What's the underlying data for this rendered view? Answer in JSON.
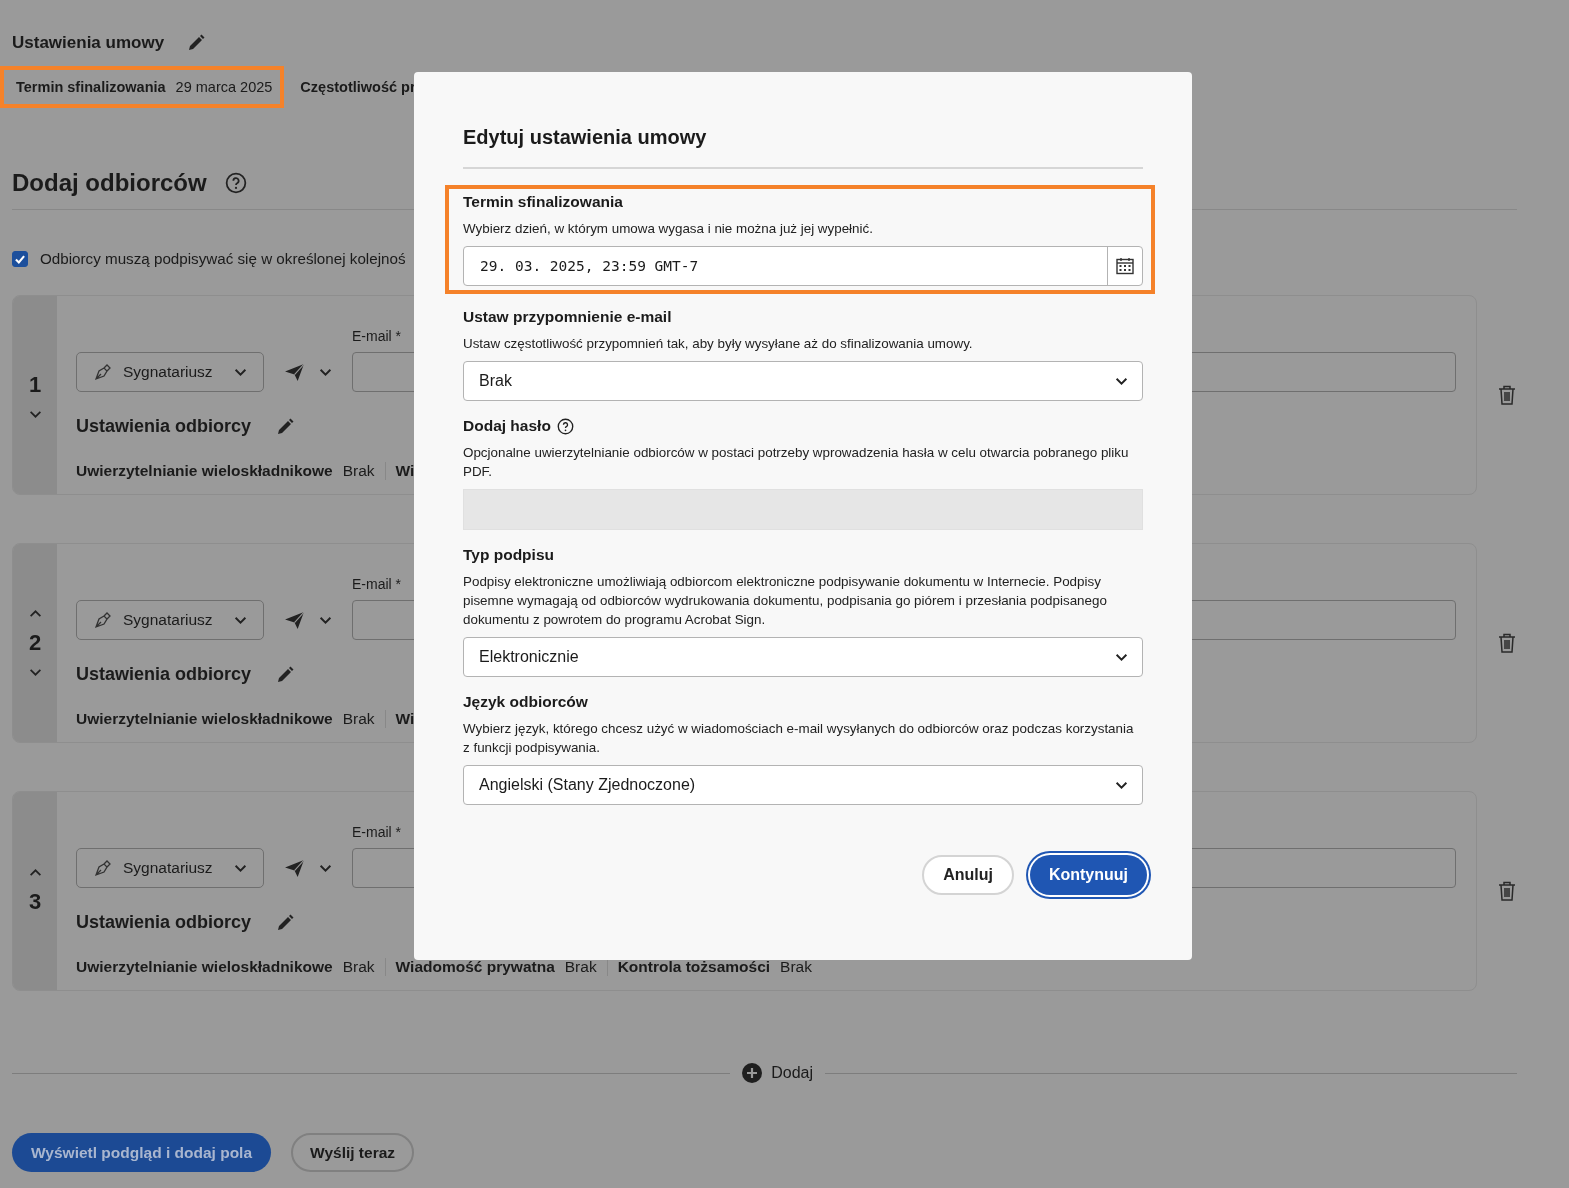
{
  "agreement_settings": {
    "title": "Ustawienia umowy",
    "summary": [
      {
        "label": "Termin sfinalizowania",
        "value": "29 marca 2025",
        "highlighted": true
      },
      {
        "label": "Częstotliwość pr",
        "highlighted": false
      }
    ]
  },
  "recipients": {
    "title": "Dodaj odbiorców",
    "ordered_signing": {
      "label": "Odbiorcy muszą podpisywać się w określonej kolejnoś",
      "checked": true
    },
    "list": [
      {
        "number": "1",
        "can_move_up": false,
        "can_move_down": true,
        "role": "Sygnatariusz",
        "email_label": "E-mail",
        "required_mark": "*",
        "settings_title": "Ustawienia odbiorcy",
        "settings": [
          {
            "label": "Uwierzytelnianie wieloskładnikowe",
            "value": "Brak"
          },
          {
            "label": "Wi"
          }
        ]
      },
      {
        "number": "2",
        "can_move_up": true,
        "can_move_down": true,
        "role": "Sygnatariusz",
        "email_label": "E-mail",
        "required_mark": "*",
        "settings_title": "Ustawienia odbiorcy",
        "settings": [
          {
            "label": "Uwierzytelnianie wieloskładnikowe",
            "value": "Brak"
          },
          {
            "label": "Wi"
          }
        ]
      },
      {
        "number": "3",
        "can_move_up": true,
        "can_move_down": false,
        "role": "Sygnatariusz",
        "email_label": "E-mail",
        "required_mark": "*",
        "settings_title": "Ustawienia odbiorcy",
        "settings": [
          {
            "label": "Uwierzytelnianie wieloskładnikowe",
            "value": "Brak"
          },
          {
            "label": "Wiadomość prywatna",
            "value": "Brak"
          },
          {
            "label": "Kontrola tożsamości",
            "value": "Brak"
          }
        ]
      }
    ],
    "add_button": "Dodaj"
  },
  "actions": [
    {
      "label": "Wyświetl podgląd i dodaj pola",
      "kind": "primary"
    },
    {
      "label": "Wyślij teraz",
      "kind": "secondary"
    }
  ],
  "modal": {
    "title": "Edytuj ustawienia umowy",
    "fields": [
      {
        "kind": "datetime",
        "label": "Termin sfinalizowania",
        "description": "Wybierz dzień, w którym umowa wygasa i nie można już jej wypełnić.",
        "value": "29. 03. 2025, 23:59 GMT-7",
        "highlighted": true
      },
      {
        "kind": "select",
        "label": "Ustaw przypomnienie e-mail",
        "description": "Ustaw częstotliwość przypomnień tak, aby były wysyłane aż do sfinalizowania umowy.",
        "value": "Brak"
      },
      {
        "kind": "password",
        "label": "Dodaj hasło",
        "help": true,
        "description": "Opcjonalne uwierzytelnianie odbiorców w postaci potrzeby wprowadzenia hasła w celu otwarcia pobranego pliku PDF.",
        "disabled": true
      },
      {
        "kind": "select",
        "label": "Typ podpisu",
        "description": "Podpisy elektroniczne umożliwiają odbiorcom elektroniczne podpisywanie dokumentu w Internecie. Podpisy pisemne wymagają od odbiorców wydrukowania dokumentu, podpisania go piórem i przesłania podpisanego dokumentu z powrotem do programu Acrobat Sign.",
        "value": "Elektronicznie"
      },
      {
        "kind": "select",
        "label": "Język odbiorców",
        "description": "Wybierz język, którego chcesz użyć w wiadomościach e-mail wysyłanych do odbiorców oraz podczas korzystania z funkcji podpisywania.",
        "value": "Angielski (Stany Zjednoczone)"
      }
    ],
    "buttons": [
      {
        "label": "Anuluj",
        "kind": "secondary",
        "focused": false
      },
      {
        "label": "Kontynuuj",
        "kind": "primary",
        "focused": true
      }
    ]
  }
}
